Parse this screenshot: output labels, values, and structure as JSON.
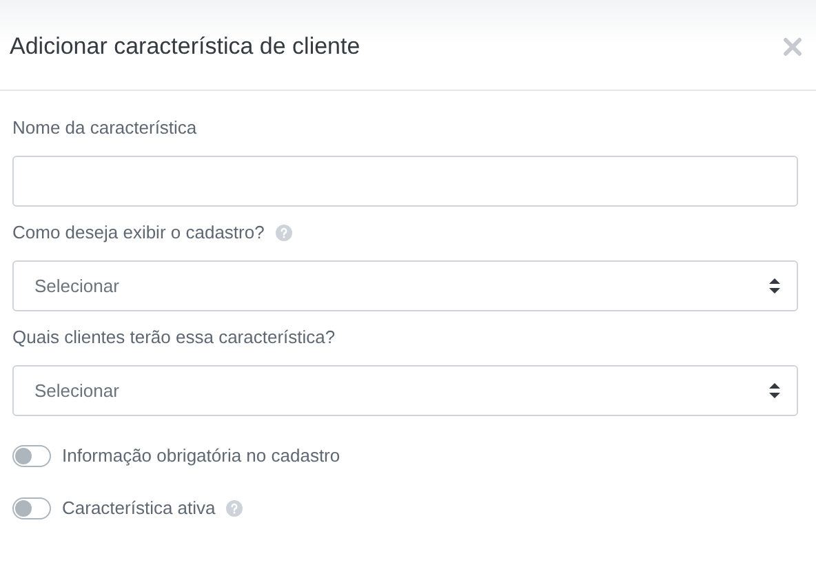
{
  "dialog": {
    "title": "Adicionar característica de cliente"
  },
  "fields": [
    {
      "kind": "text",
      "label": "Nome da característica",
      "help": false
    },
    {
      "kind": "select",
      "label": "Como deseja exibir o cadastro?",
      "help": true,
      "placeholder": "Selecionar"
    },
    {
      "kind": "select",
      "label": "Quais clientes terão essa característica?",
      "help": false,
      "placeholder": "Selecionar"
    }
  ],
  "toggles": [
    {
      "label": "Informação obrigatória no cadastro",
      "on": false,
      "help": false
    },
    {
      "label": "Característica ativa",
      "on": false,
      "help": true
    }
  ]
}
